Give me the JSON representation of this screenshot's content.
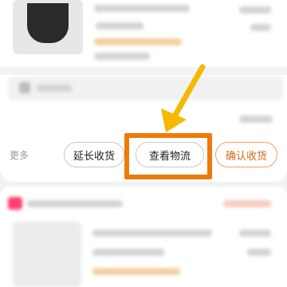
{
  "actions": {
    "more_label": "更多",
    "extend_receipt_label": "延长收货",
    "view_logistics_label": "查看物流",
    "confirm_receipt_label": "确认收货"
  },
  "colors": {
    "highlight": "#f07a07",
    "arrow": "#f6b800",
    "confirm_accent": "#d36a10",
    "badge": "#ff3b72"
  }
}
